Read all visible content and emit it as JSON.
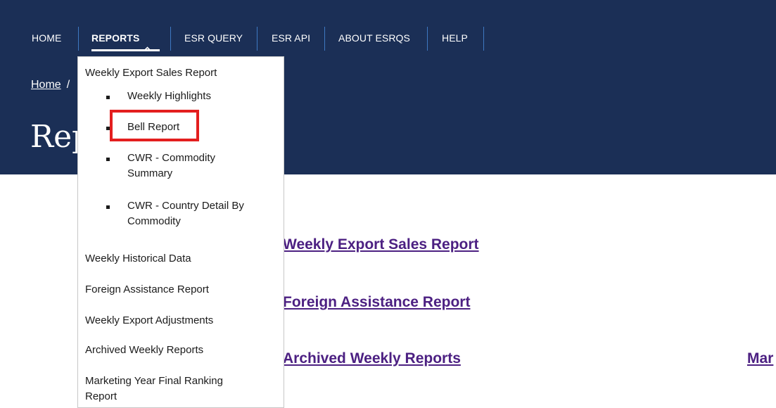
{
  "nav": {
    "items": [
      "HOME",
      "REPORTS",
      "ESR QUERY",
      "ESR API",
      "ABOUT ESRQS",
      "HELP"
    ]
  },
  "breadcrumb": {
    "home": "Home",
    "separator": "/"
  },
  "page_title": "Rep",
  "dropdown": {
    "section_heading": "Weekly Export Sales Report",
    "sub_items": [
      "Weekly Highlights",
      "Bell Report",
      "CWR - Commodity Summary",
      "CWR - Country Detail By Commodity"
    ],
    "items": [
      "Weekly Historical Data",
      "Foreign Assistance Report",
      "Weekly Export Adjustments",
      "Archived Weekly Reports",
      "Marketing Year Final Ranking Report"
    ]
  },
  "content_links": [
    "Weekly Export Sales Report",
    "Foreign Assistance Report",
    "Archived Weekly Reports",
    "Mar"
  ],
  "colors": {
    "banner": "#1b2f56",
    "link": "#4c2082",
    "highlight": "#e31e1e"
  },
  "icons": {
    "reports_chevron": "chevron-up-icon"
  }
}
